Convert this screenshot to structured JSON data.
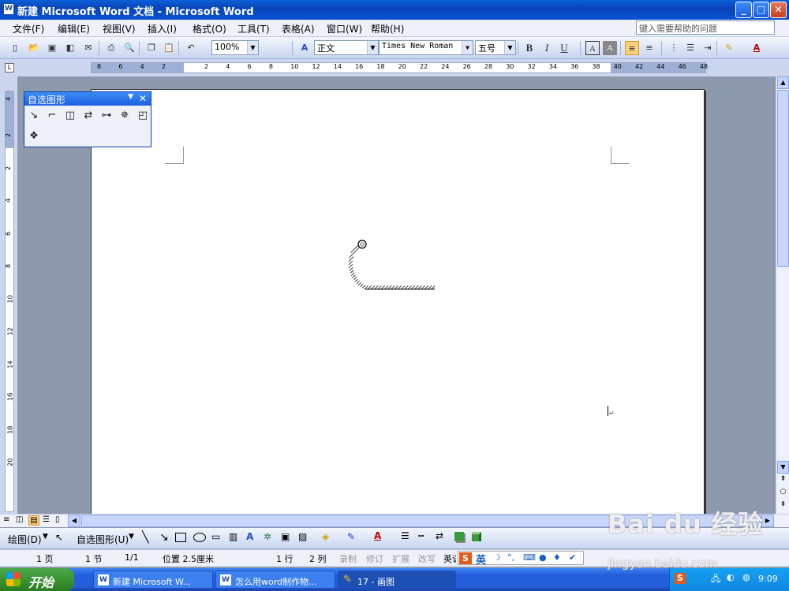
{
  "window": {
    "title": "新建 Microsoft Word 文档 - Microsoft Word",
    "icon": "W",
    "min": "_",
    "max": "□",
    "close": "✕"
  },
  "menu": {
    "items": [
      "文件(F)",
      "编辑(E)",
      "视图(V)",
      "插入(I)",
      "格式(O)",
      "工具(T)",
      "表格(A)",
      "窗口(W)",
      "帮助(H)"
    ],
    "help_placeholder": "键入需要帮助的问题"
  },
  "toolbar": {
    "zoom": "100%",
    "style": "正文",
    "font": "Times New Roman",
    "size": "五号",
    "bold": "B",
    "italic": "I",
    "underline": "U",
    "charborder": "A",
    "charshade": "A"
  },
  "ruler": {
    "h_ticks": [
      "8",
      "6",
      "4",
      "2",
      "2",
      "4",
      "6",
      "8",
      "10",
      "12",
      "14",
      "16",
      "18",
      "20",
      "22",
      "24",
      "26",
      "28",
      "30",
      "32",
      "34",
      "36",
      "38",
      "40",
      "42",
      "44",
      "46",
      "48"
    ],
    "v_ticks": [
      "4",
      "2",
      "2",
      "4",
      "6",
      "8",
      "10",
      "12",
      "14",
      "16",
      "18",
      "20"
    ]
  },
  "autoshapes": {
    "title": "自选图形",
    "close": "✕",
    "arrow": "▼"
  },
  "drawbar": {
    "draw": "绘图(D)",
    "autoshapes": "自选图形(U)"
  },
  "status": {
    "page": "1 页",
    "section": "1 节",
    "pages": "1/1",
    "position": "位置 2.5厘米",
    "line": "1 行",
    "col": "2 列",
    "rec": "录制",
    "trk": "修订",
    "ext": "扩展",
    "ovr": "改写",
    "lang": "英语"
  },
  "taskbar": {
    "start": "开始",
    "tasks": [
      "新建 Microsoft W...",
      "怎么用word制作物...",
      "17 - 画图"
    ],
    "clock": "9:09"
  },
  "ime": {
    "mode": "英"
  },
  "watermark": {
    "brand": "Bai du 经验",
    "url": "jingyan.baidu.com"
  }
}
